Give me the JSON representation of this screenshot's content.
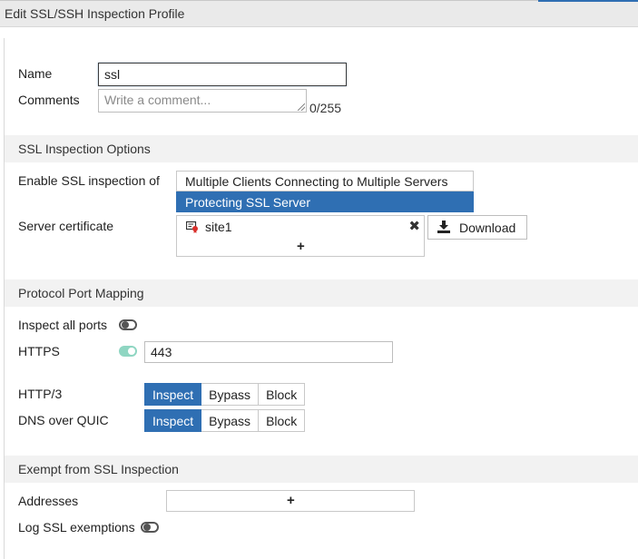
{
  "window": {
    "title": "Edit SSL/SSH Inspection Profile"
  },
  "form": {
    "name_label": "Name",
    "name_value": "ssl",
    "comments_label": "Comments",
    "comments_placeholder": "Write a comment...",
    "comments_counter": "0/255"
  },
  "ssl_options": {
    "section_title": "SSL Inspection Options",
    "enable_label": "Enable SSL inspection of",
    "enable_options": [
      {
        "label": "Multiple Clients Connecting to Multiple Servers",
        "selected": false
      },
      {
        "label": "Protecting SSL Server",
        "selected": true
      }
    ],
    "server_cert_label": "Server certificate",
    "certificates": [
      {
        "name": "site1",
        "icon": "certificate-icon"
      }
    ],
    "add_icon": "+",
    "remove_icon": "✖",
    "download_icon": "download-icon",
    "download_label": "Download"
  },
  "port_mapping": {
    "section_title": "Protocol Port Mapping",
    "inspect_all_label": "Inspect all ports",
    "inspect_all_enabled": false,
    "https_label": "HTTPS",
    "https_enabled": true,
    "https_port": "443",
    "http3_label": "HTTP/3",
    "dns_quic_label": "DNS over QUIC",
    "action_options": [
      "Inspect",
      "Bypass",
      "Block"
    ],
    "http3_selected": "Inspect",
    "dns_quic_selected": "Inspect"
  },
  "exempt": {
    "section_title": "Exempt from SSL Inspection",
    "addresses_label": "Addresses",
    "add_icon": "+",
    "log_label": "Log SSL exemptions",
    "log_enabled": false
  },
  "colors": {
    "accent": "#2f6fb3",
    "toggle_on": "#8fd6c2",
    "section_bg": "#f2f2f2",
    "titlebar_bg": "#eaeaea"
  }
}
